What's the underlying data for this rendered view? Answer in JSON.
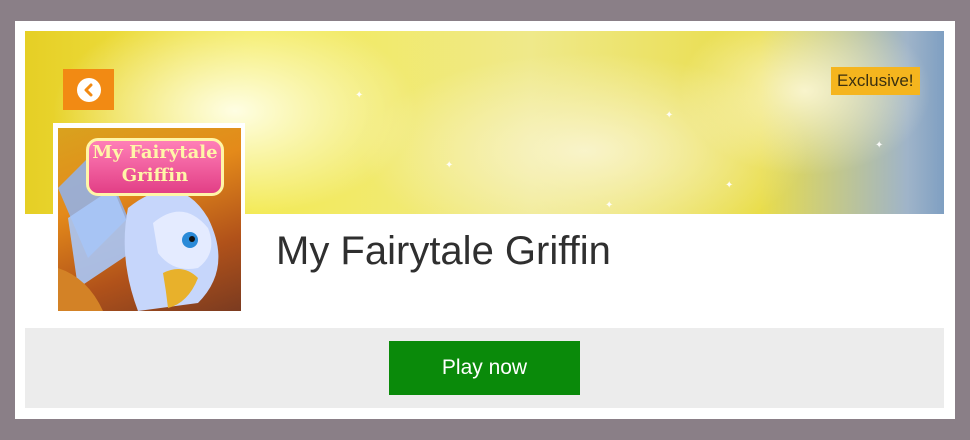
{
  "badge": {
    "label": "Exclusive!"
  },
  "game": {
    "title": "My Fairytale Griffin",
    "thumbnail_lines": [
      "My Fairytale",
      "Griffin"
    ]
  },
  "actions": {
    "play_label": "Play now"
  },
  "icons": {
    "back": "chevron-left-icon"
  },
  "colors": {
    "background": "#8a7f87",
    "back_button": "#f28a13",
    "badge": "#f5b51e",
    "play_button": "#0a8a0a",
    "footer": "#ececec"
  }
}
